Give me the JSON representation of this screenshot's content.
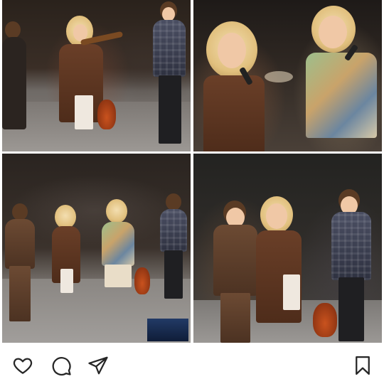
{
  "post": {
    "photos": [
      {
        "name": "violinist-and-band-photo"
      },
      {
        "name": "two-singers-photo"
      },
      {
        "name": "group-on-stage-photo"
      },
      {
        "name": "trio-singing-photo"
      }
    ]
  },
  "actions": {
    "like_icon": "heart-icon",
    "comment_icon": "comment-bubble-icon",
    "share_icon": "paper-plane-icon",
    "save_icon": "bookmark-icon"
  },
  "colors": {
    "icon_stroke": "#262626",
    "background": "#ffffff"
  }
}
